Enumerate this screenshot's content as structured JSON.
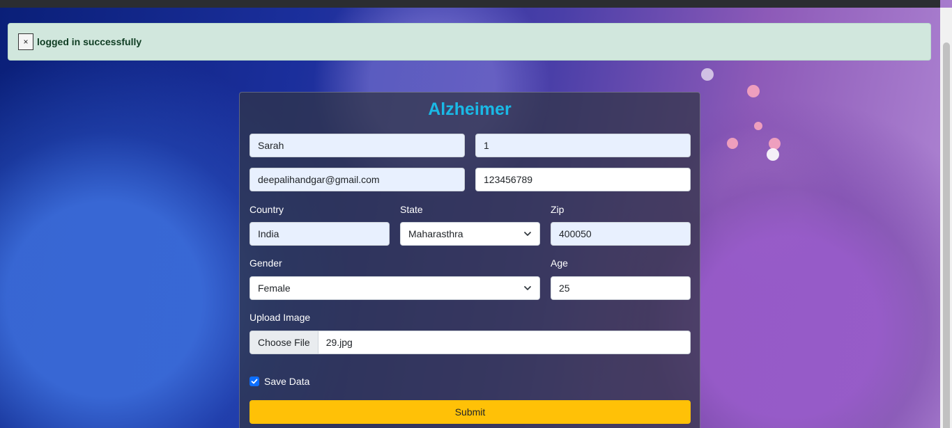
{
  "alert": {
    "close_label": "×",
    "message": "logged in successfully"
  },
  "form": {
    "title": "Alzheimer",
    "first_name": "Sarah",
    "second_field": "1",
    "email": "deepalihandgar@gmail.com",
    "phone": "123456789",
    "country_label": "Country",
    "country": "India",
    "state_label": "State",
    "state": "Maharasthra",
    "zip_label": "Zip",
    "zip": "400050",
    "gender_label": "Gender",
    "gender": "Female",
    "age_label": "Age",
    "age": "25",
    "upload_label": "Upload Image",
    "choose_file": "Choose File",
    "file_name": "29.jpg",
    "save_label": "Save Data",
    "submit": "Submit"
  },
  "colors": {
    "title": "#1ab9e6",
    "submit": "#ffc107",
    "alert_bg": "#d1e7dd",
    "checkbox": "#0d6efd"
  }
}
